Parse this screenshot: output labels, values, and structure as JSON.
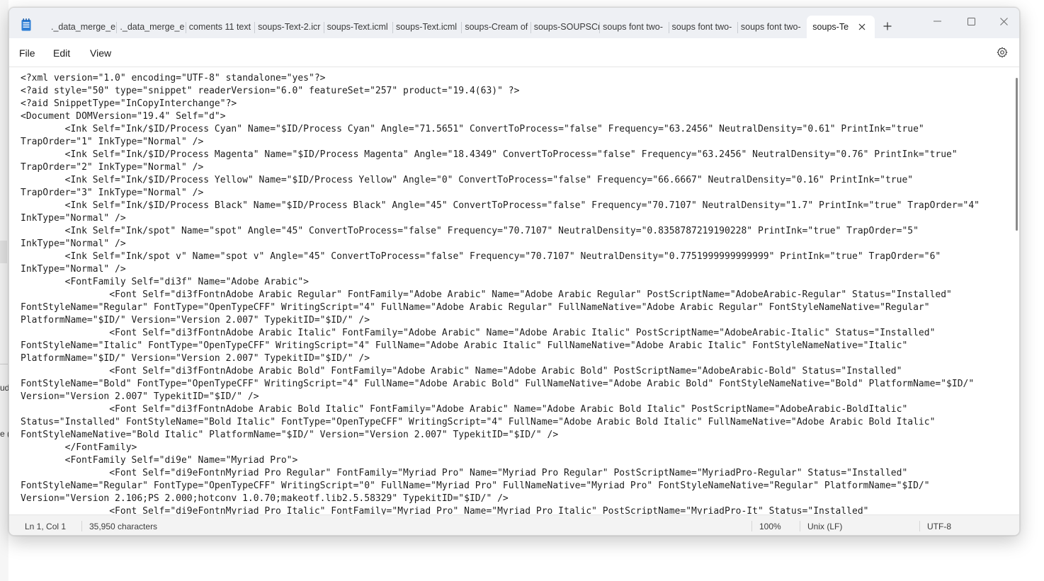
{
  "background": {
    "fragments": [
      "ud",
      "e ("
    ]
  },
  "window": {
    "app_icon": "notepad-icon",
    "tabs": [
      {
        "label": "._data_merge_e"
      },
      {
        "label": "._data_merge_e"
      },
      {
        "label": "coments 11  text"
      },
      {
        "label": "soups-Text-2.icr"
      },
      {
        "label": "soups-Text.icml"
      },
      {
        "label": "soups-Text.icml"
      },
      {
        "label": "soups-Cream of"
      },
      {
        "label": "soups-SOUPSCr"
      },
      {
        "label": "soups font two-"
      },
      {
        "label": "soups font two-"
      },
      {
        "label": "soups font two-"
      }
    ],
    "active_tab": {
      "label": "soups-Te"
    },
    "controls": {
      "minimize": "minimize-icon",
      "maximize": "maximize-icon",
      "close": "close-icon"
    }
  },
  "menu": {
    "items": [
      "File",
      "Edit",
      "View"
    ],
    "settings_icon": "gear-icon"
  },
  "editor": {
    "lines": [
      "<?xml version=\"1.0\" encoding=\"UTF-8\" standalone=\"yes\"?>",
      "<?aid style=\"50\" type=\"snippet\" readerVersion=\"6.0\" featureSet=\"257\" product=\"19.4(63)\" ?>",
      "<?aid SnippetType=\"InCopyInterchange\"?>",
      "<Document DOMVersion=\"19.4\" Self=\"d\">",
      "        <Ink Self=\"Ink/$ID/Process Cyan\" Name=\"$ID/Process Cyan\" Angle=\"71.5651\" ConvertToProcess=\"false\" Frequency=\"63.2456\" NeutralDensity=\"0.61\" PrintInk=\"true\"",
      "TrapOrder=\"1\" InkType=\"Normal\" />",
      "        <Ink Self=\"Ink/$ID/Process Magenta\" Name=\"$ID/Process Magenta\" Angle=\"18.4349\" ConvertToProcess=\"false\" Frequency=\"63.2456\" NeutralDensity=\"0.76\" PrintInk=\"true\"",
      "TrapOrder=\"2\" InkType=\"Normal\" />",
      "        <Ink Self=\"Ink/$ID/Process Yellow\" Name=\"$ID/Process Yellow\" Angle=\"0\" ConvertToProcess=\"false\" Frequency=\"66.6667\" NeutralDensity=\"0.16\" PrintInk=\"true\"",
      "TrapOrder=\"3\" InkType=\"Normal\" />",
      "        <Ink Self=\"Ink/$ID/Process Black\" Name=\"$ID/Process Black\" Angle=\"45\" ConvertToProcess=\"false\" Frequency=\"70.7107\" NeutralDensity=\"1.7\" PrintInk=\"true\" TrapOrder=\"4\"",
      "InkType=\"Normal\" />",
      "        <Ink Self=\"Ink/spot\" Name=\"spot\" Angle=\"45\" ConvertToProcess=\"false\" Frequency=\"70.7107\" NeutralDensity=\"0.8358787219190228\" PrintInk=\"true\" TrapOrder=\"5\"",
      "InkType=\"Normal\" />",
      "        <Ink Self=\"Ink/spot v\" Name=\"spot v\" Angle=\"45\" ConvertToProcess=\"false\" Frequency=\"70.7107\" NeutralDensity=\"0.7751999999999999\" PrintInk=\"true\" TrapOrder=\"6\"",
      "InkType=\"Normal\" />",
      "        <FontFamily Self=\"di3f\" Name=\"Adobe Arabic\">",
      "                <Font Self=\"di3fFontnAdobe Arabic Regular\" FontFamily=\"Adobe Arabic\" Name=\"Adobe Arabic Regular\" PostScriptName=\"AdobeArabic-Regular\" Status=\"Installed\"",
      "FontStyleName=\"Regular\" FontType=\"OpenTypeCFF\" WritingScript=\"4\" FullName=\"Adobe Arabic Regular\" FullNameNative=\"Adobe Arabic Regular\" FontStyleNameNative=\"Regular\"",
      "PlatformName=\"$ID/\" Version=\"Version 2.007\" TypekitID=\"$ID/\" />",
      "                <Font Self=\"di3fFontnAdobe Arabic Italic\" FontFamily=\"Adobe Arabic\" Name=\"Adobe Arabic Italic\" PostScriptName=\"AdobeArabic-Italic\" Status=\"Installed\"",
      "FontStyleName=\"Italic\" FontType=\"OpenTypeCFF\" WritingScript=\"4\" FullName=\"Adobe Arabic Italic\" FullNameNative=\"Adobe Arabic Italic\" FontStyleNameNative=\"Italic\"",
      "PlatformName=\"$ID/\" Version=\"Version 2.007\" TypekitID=\"$ID/\" />",
      "                <Font Self=\"di3fFontnAdobe Arabic Bold\" FontFamily=\"Adobe Arabic\" Name=\"Adobe Arabic Bold\" PostScriptName=\"AdobeArabic-Bold\" Status=\"Installed\"",
      "FontStyleName=\"Bold\" FontType=\"OpenTypeCFF\" WritingScript=\"4\" FullName=\"Adobe Arabic Bold\" FullNameNative=\"Adobe Arabic Bold\" FontStyleNameNative=\"Bold\" PlatformName=\"$ID/\"",
      "Version=\"Version 2.007\" TypekitID=\"$ID/\" />",
      "                <Font Self=\"di3fFontnAdobe Arabic Bold Italic\" FontFamily=\"Adobe Arabic\" Name=\"Adobe Arabic Bold Italic\" PostScriptName=\"AdobeArabic-BoldItalic\"",
      "Status=\"Installed\" FontStyleName=\"Bold Italic\" FontType=\"OpenTypeCFF\" WritingScript=\"4\" FullName=\"Adobe Arabic Bold Italic\" FullNameNative=\"Adobe Arabic Bold Italic\"",
      "FontStyleNameNative=\"Bold Italic\" PlatformName=\"$ID/\" Version=\"Version 2.007\" TypekitID=\"$ID/\" />",
      "        </FontFamily>",
      "        <FontFamily Self=\"di9e\" Name=\"Myriad Pro\">",
      "                <Font Self=\"di9eFontnMyriad Pro Regular\" FontFamily=\"Myriad Pro\" Name=\"Myriad Pro Regular\" PostScriptName=\"MyriadPro-Regular\" Status=\"Installed\"",
      "FontStyleName=\"Regular\" FontType=\"OpenTypeCFF\" WritingScript=\"0\" FullName=\"Myriad Pro\" FullNameNative=\"Myriad Pro\" FontStyleNameNative=\"Regular\" PlatformName=\"$ID/\"",
      "Version=\"Version 2.106;PS 2.000;hotconv 1.0.70;makeotf.lib2.5.58329\" TypekitID=\"$ID/\" />",
      "                <Font Self=\"di9eFontnMyriad Pro Italic\" FontFamily=\"Myriad Pro\" Name=\"Myriad Pro Italic\" PostScriptName=\"MyriadPro-It\" Status=\"Installed\""
    ]
  },
  "status": {
    "position": "Ln 1, Col 1",
    "characters": "35,950 characters",
    "zoom": "100%",
    "line_ending": "Unix (LF)",
    "encoding": "UTF-8"
  }
}
